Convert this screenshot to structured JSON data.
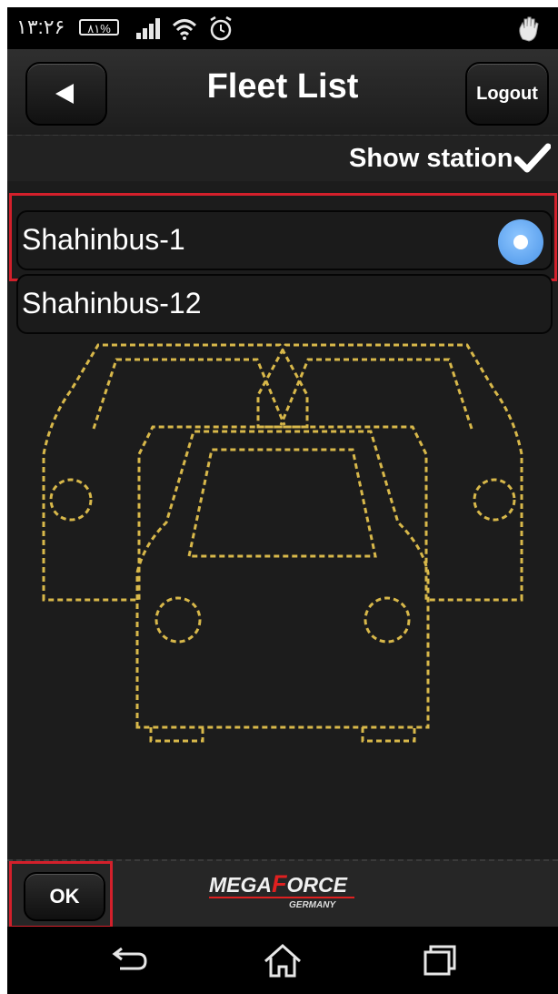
{
  "status_bar": {
    "time": "۱۳:۲۶",
    "battery": "۸۱%",
    "icons": [
      "signal-icon",
      "wifi-icon",
      "alarm-icon",
      "hand-icon"
    ]
  },
  "header": {
    "title": "Fleet List",
    "back_icon": "back-arrow-icon",
    "logout_label": "Logout"
  },
  "station_toggle": {
    "label": "Show station",
    "checked": true
  },
  "fleet": [
    {
      "label": "Shahinbus-1",
      "selected": true
    },
    {
      "label": "Shahinbus-12",
      "selected": false
    }
  ],
  "footer": {
    "ok_label": "OK",
    "logo": {
      "brand_prefix": "MEGA",
      "brand_letter": "F",
      "brand_suffix": "ORCE",
      "sub": "GERMANY"
    }
  },
  "nav": [
    "back-icon",
    "home-icon",
    "recents-icon"
  ],
  "colors": {
    "highlight": "#d3202b",
    "radio": "#4a94e8",
    "stitch": "#d8b84a"
  }
}
